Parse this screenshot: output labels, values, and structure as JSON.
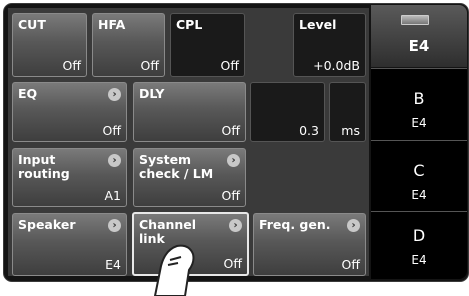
{
  "buttons": {
    "cut": {
      "label": "CUT",
      "value": "Off"
    },
    "hfa": {
      "label": "HFA",
      "value": "Off"
    },
    "cpl": {
      "label": "CPL",
      "value": "Off"
    },
    "level": {
      "label": "Level",
      "value": "+0.0dB"
    },
    "eq": {
      "label": "EQ",
      "value": "Off"
    },
    "dly": {
      "label": "DLY",
      "value": "Off"
    },
    "dly_value": "0.3",
    "dly_unit": "ms",
    "input_routing": {
      "label": "Input\nrouting",
      "value": "A1"
    },
    "system_check": {
      "label": "System\ncheck / LM",
      "value": "Off"
    },
    "speaker": {
      "label": "Speaker",
      "value": "E4"
    },
    "channel_link": {
      "label": "Channel\nlink",
      "value": "Off"
    },
    "freq_gen": {
      "label": "Freq. gen.",
      "value": "Off"
    }
  },
  "channels": [
    {
      "name": "E4",
      "active": true
    },
    {
      "name": "B",
      "sub": "E4"
    },
    {
      "name": "C",
      "sub": "E4"
    },
    {
      "name": "D",
      "sub": "E4"
    }
  ],
  "icons": {
    "chevron": "chevron-right-icon",
    "hand": "touch-hand-icon"
  }
}
